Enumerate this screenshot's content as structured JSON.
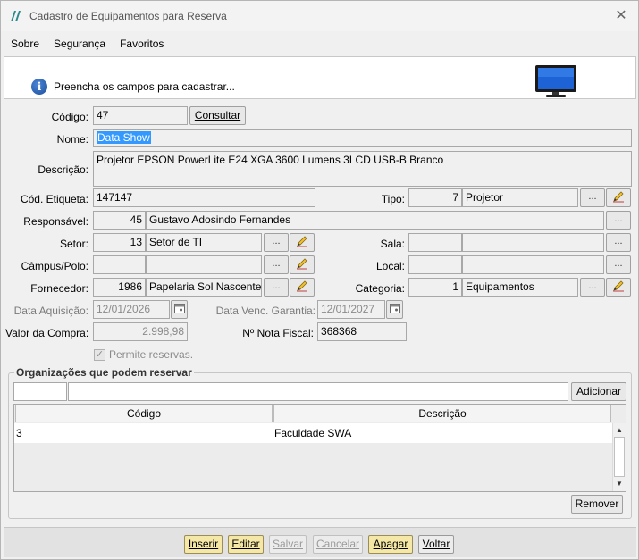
{
  "window": {
    "title": "Cadastro de Equipamentos para Reserva"
  },
  "menu": {
    "items": [
      "Sobre",
      "Segurança",
      "Favoritos"
    ]
  },
  "header": {
    "message": "Preencha os campos para cadastrar..."
  },
  "form": {
    "codigo_label": "Código:",
    "codigo_value": "47",
    "consultar_label": "Consultar",
    "nome_label": "Nome:",
    "nome_value": "Data Show",
    "descricao_label": "Descrição:",
    "descricao_value": "Projetor EPSON PowerLite E24 XGA 3600 Lumens 3LCD USB-B Branco",
    "etiqueta_label": "Cód. Etiqueta:",
    "etiqueta_value": "147147",
    "tipo_label": "Tipo:",
    "tipo_code": "7",
    "tipo_value": "Projetor",
    "responsavel_label": "Responsável:",
    "responsavel_code": "45",
    "responsavel_value": "Gustavo Adosindo Fernandes",
    "setor_label": "Setor:",
    "setor_code": "13",
    "setor_value": "Setor de TI",
    "sala_label": "Sala:",
    "sala_code": "",
    "sala_value": "",
    "campus_label": "Câmpus/Polo:",
    "campus_code": "",
    "campus_value": "",
    "local_label": "Local:",
    "local_code": "",
    "local_value": "",
    "fornecedor_label": "Fornecedor:",
    "fornecedor_code": "1986",
    "fornecedor_value": "Papelaria Sol Nascente",
    "categoria_label": "Categoria:",
    "categoria_code": "1",
    "categoria_value": "Equipamentos",
    "data_aquisicao_label": "Data Aquisição:",
    "data_aquisicao_value": "12/01/2026",
    "data_garantia_label": "Data Venc. Garantia:",
    "data_garantia_value": "12/01/2027",
    "valor_label": "Valor da Compra:",
    "valor_value": "2.998,98",
    "nota_label": "Nº Nota Fiscal:",
    "nota_value": "368368",
    "permite_label": "Permite reservas.",
    "dots": "..."
  },
  "organizations": {
    "title": "Organizações que podem reservar",
    "add_code": "",
    "add_name": "",
    "adicionar_label": "Adicionar",
    "columns": [
      "Código",
      "Descrição"
    ],
    "rows": [
      {
        "codigo": "3",
        "descricao": "Faculdade SWA"
      }
    ],
    "remover_label": "Remover"
  },
  "footer": {
    "inserir": "Inserir",
    "editar": "Editar",
    "salvar": "Salvar",
    "cancelar": "Cancelar",
    "apagar": "Apagar",
    "voltar": "Voltar"
  }
}
